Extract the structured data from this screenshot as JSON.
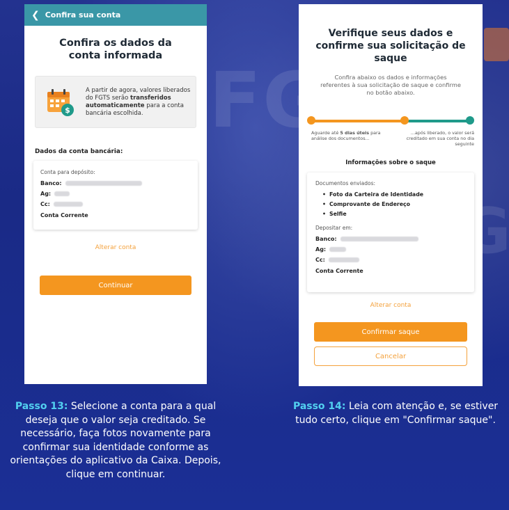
{
  "colors": {
    "teal_header": "#3a97a7",
    "accent_orange": "#f4961f",
    "link_orange": "#f4a13b",
    "caption_highlight": "#52d0f0",
    "progress_teal": "#1f9a8a"
  },
  "background": {
    "watermark_1": "FGT",
    "watermark_2": "GT"
  },
  "left_phone": {
    "header_title": "Confira sua conta",
    "title_line1": "Confira os dados da",
    "title_line2": "conta informada",
    "info": {
      "icon": "calendar-money-icon",
      "text_1": "A partir de agora, valores liberados do FGTS serão ",
      "text_bold": "transferidos automaticamente",
      "text_2": " para a conta bancária escolhida."
    },
    "section_title": "Dados da conta bancária:",
    "account": {
      "label": "Conta para depósito:",
      "banco_key": "Banco:",
      "ag_key": "Ag:",
      "cc_key": "Cc:",
      "type": "Conta Corrente"
    },
    "change_link": "Alterar conta",
    "continue_button": "Continuar"
  },
  "right_phone": {
    "title_line1": "Verifique seus dados e",
    "title_line2": "confirme sua solicitação de",
    "title_line3": "saque",
    "subtitle": "Confira abaixo os dados e informações referentes à sua solicitação de saque e confirme no botão abaixo.",
    "progress": {
      "step": 2,
      "total": 3
    },
    "step_1_pre": "Aguarde até ",
    "step_1_bold": "5 dias úteis",
    "step_1_post": " para análise dos documentos...",
    "step_2": "...após liberado, o valor será creditado em sua conta no dia seguinte",
    "section_title": "Informações sobre o saque",
    "docs_label": "Documentos enviados:",
    "docs": [
      "Foto da Carteira de Identidade",
      "Comprovante de Endereço",
      "Selfie"
    ],
    "deposit_label": "Depositar em:",
    "banco_key": "Banco:",
    "ag_key": "Ag:",
    "cc_key": "Cc:",
    "account_type": "Conta Corrente",
    "change_link": "Alterar conta",
    "confirm_button": "Confirmar saque",
    "cancel_button": "Cancelar"
  },
  "captions": {
    "left_step": "Passo 13:",
    "left_text": " Selecione a conta para a qual deseja que o valor seja creditado. Se necessário, faça fotos novamente para confirmar sua identidade conforme as orientações do aplicativo da Caixa. Depois, clique em continuar.",
    "right_step": "Passo 14:",
    "right_text": " Leia com atenção e, se estiver tudo certo, clique em \"Confirmar saque\"."
  }
}
